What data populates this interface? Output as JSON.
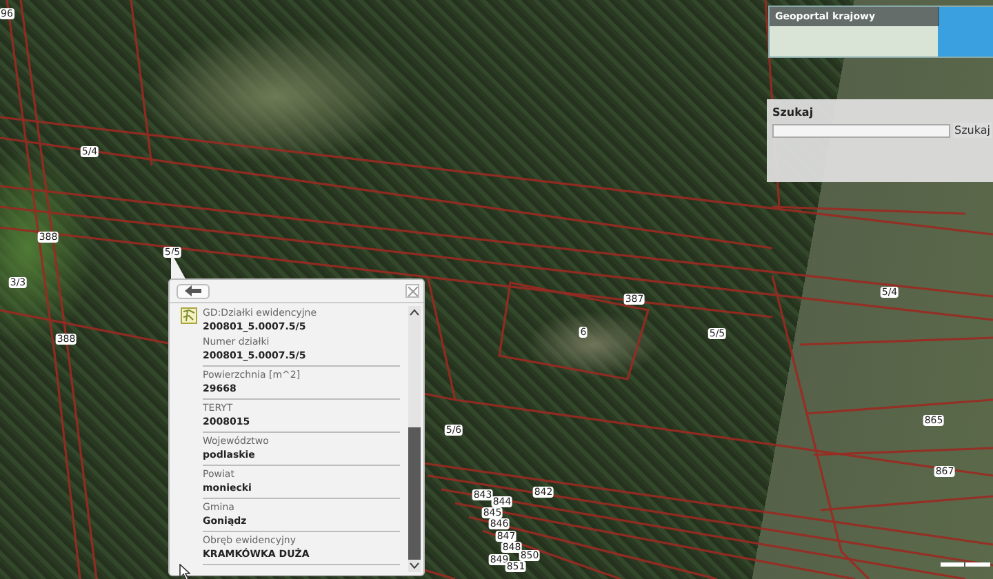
{
  "map_labels": [
    {
      "text": "96"
    },
    {
      "text": "5/4"
    },
    {
      "text": "388"
    },
    {
      "text": "5/5"
    },
    {
      "text": "3/3"
    },
    {
      "text": "388"
    },
    {
      "text": "387"
    },
    {
      "text": "6"
    },
    {
      "text": "5/5"
    },
    {
      "text": "5/6"
    },
    {
      "text": "842"
    },
    {
      "text": "843"
    },
    {
      "text": "844"
    },
    {
      "text": "845"
    },
    {
      "text": "846"
    },
    {
      "text": "847"
    },
    {
      "text": "848"
    },
    {
      "text": "849"
    },
    {
      "text": "850"
    },
    {
      "text": "851"
    },
    {
      "text": "5/4"
    },
    {
      "text": "865"
    },
    {
      "text": "867"
    }
  ],
  "overview_panel": {
    "title": "Geoportal krajowy"
  },
  "search_panel": {
    "label": "Szukaj",
    "button": "Szukaj"
  },
  "popup": {
    "layer": "GD:Działki ewidencyjne",
    "layer_value": "200801_5.0007.5/5",
    "fields": [
      {
        "label": "Numer działki",
        "value": "200801_5.0007.5/5"
      },
      {
        "label": "Powierzchnia [m^2]",
        "value": "29668"
      },
      {
        "label": "TERYT",
        "value": "2008015"
      },
      {
        "label": "Województwo",
        "value": "podlaskie"
      },
      {
        "label": "Powiat",
        "value": "moniecki"
      },
      {
        "label": "Gmina",
        "value": "Goniądz"
      },
      {
        "label": "Obręb ewidencyjny",
        "value": "KRAMKÓWKA DUŻA"
      }
    ]
  }
}
